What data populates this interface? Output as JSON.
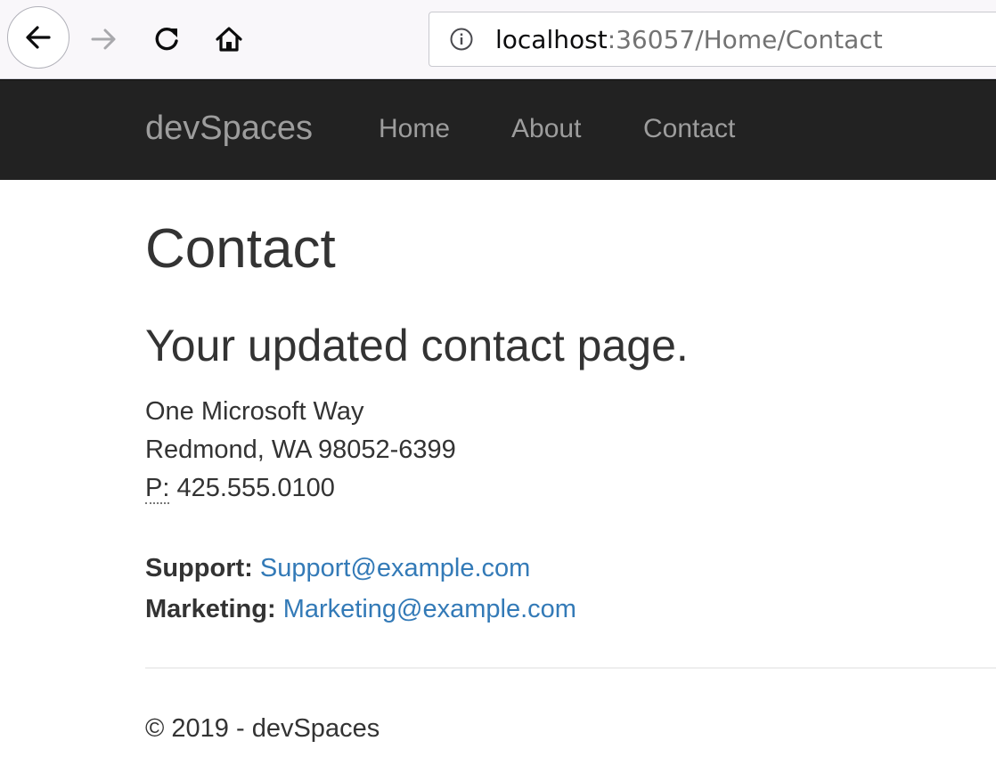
{
  "browser": {
    "url_host": "localhost",
    "url_rest": ":36057/Home/Contact",
    "icons": {
      "back": "back-arrow-icon",
      "forward": "forward-arrow-icon",
      "reload": "reload-icon",
      "home": "home-icon",
      "info": "info-icon"
    }
  },
  "navbar": {
    "brand": "devSpaces",
    "items": [
      {
        "label": "Home"
      },
      {
        "label": "About"
      },
      {
        "label": "Contact"
      }
    ],
    "background": "#222222",
    "text_color": "#9d9d9d"
  },
  "main": {
    "title": "Contact",
    "subtitle": "Your updated contact page.",
    "address": {
      "line1": "One Microsoft Way",
      "line2": "Redmond, WA 98052-6399",
      "phone_label": "P:",
      "phone": "425.555.0100"
    },
    "support": {
      "label": "Support:",
      "email": "Support@example.com"
    },
    "marketing": {
      "label": "Marketing:",
      "email": "Marketing@example.com"
    },
    "link_color": "#337ab7"
  },
  "footer": {
    "text": "© 2019 - devSpaces"
  }
}
